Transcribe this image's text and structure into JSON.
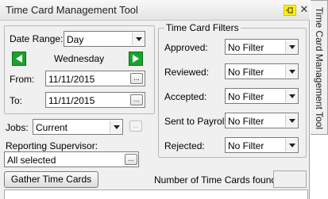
{
  "window": {
    "title": "Time Card Management Tool",
    "pin_icon": "pin-icon",
    "close_glyph": "✕"
  },
  "side_tab": {
    "label": "Time Card Management Tool"
  },
  "date_range": {
    "label": "Date Range:",
    "selected": "Day",
    "day_label": "Wednesday",
    "from_label": "From:",
    "from_value": "11/11/2015",
    "to_label": "To:",
    "to_value": "11/11/2015",
    "ellipsis": "..."
  },
  "filters": {
    "group_label": "Time Card Filters",
    "items": [
      {
        "label": "Approved:",
        "value": "No Filter"
      },
      {
        "label": "Reviewed:",
        "value": "No Filter"
      },
      {
        "label": "Accepted:",
        "value": "No Filter"
      },
      {
        "label": "Sent to Payroll:",
        "value": "No Filter"
      },
      {
        "label": "Rejected:",
        "value": "No Filter"
      }
    ]
  },
  "jobs": {
    "label": "Jobs:",
    "selected": "Current",
    "ellipsis": "..."
  },
  "supervisor": {
    "label": "Reporting Supervisor:",
    "value": "All selected",
    "ellipsis": "..."
  },
  "actions": {
    "gather_label": "Gather Time Cards"
  },
  "count": {
    "label": "Number of Time Cards found:",
    "value": ""
  },
  "colors": {
    "nav_arrow": "#1aa32c",
    "pin_highlight": "#fff200"
  }
}
